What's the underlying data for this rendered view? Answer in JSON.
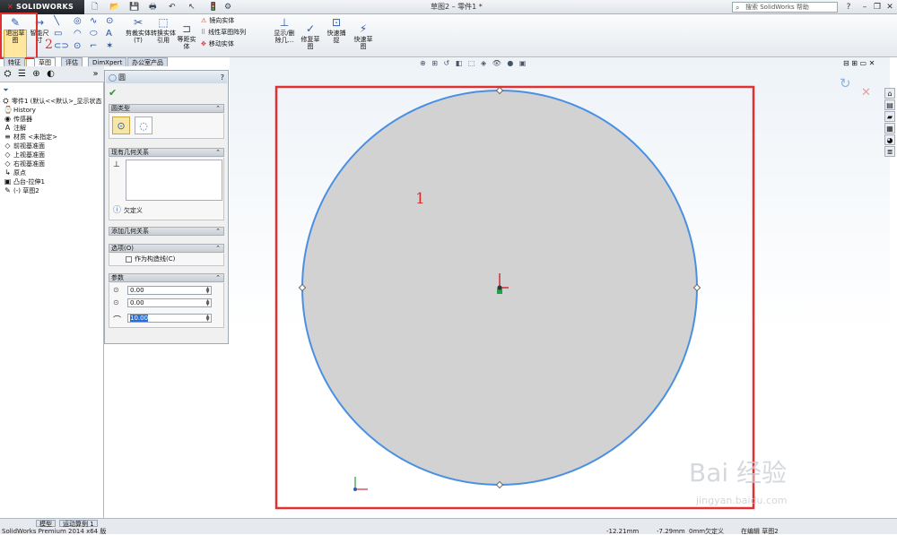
{
  "titlebar": {
    "brand": "SOLIDWORKS",
    "doc_title": "草图2 – 零件1 *",
    "search_placeholder": "搜索 SolidWorks 帮助"
  },
  "ribbon": {
    "exit_sketch": "退出草图",
    "smart_dim": "智能尺寸",
    "trim": "剪裁实体(T)",
    "convert": "转换实体引用",
    "offset": "等距实体",
    "mirror": "镜向实体",
    "linear_pattern": "线性草图阵列",
    "move": "移动实体",
    "display_delete": "显示/删除几...",
    "repair": "修复草图",
    "quick_snap": "快速捕捉",
    "rapid_sketch": "快速草图"
  },
  "annotations": {
    "a1": "1",
    "a2": "2"
  },
  "tabs": [
    "特征",
    "草图",
    "评估",
    "DimXpert",
    "办公室产品"
  ],
  "tree": {
    "root": "零件1 (默认<<默认>_显示状态",
    "items": [
      "History",
      "传感器",
      "注解",
      "材质 <未指定>",
      "前视基准面",
      "上视基准面",
      "右视基准面",
      "原点",
      "凸台-拉伸1",
      "(-) 草图2"
    ]
  },
  "pm": {
    "title": "圆",
    "circle_type": "圆类型",
    "existing_relations": "现有几何关系",
    "status": "欠定义",
    "add_relations": "添加几何关系",
    "options": "选项(O)",
    "construction": "作为构造线(C)",
    "params": "参数",
    "cx": "0.00",
    "cy": "0.00",
    "radius": "10.00"
  },
  "statusbar": {
    "tab_model": "模型",
    "tab_motion": "运动算例 1",
    "product": "SolidWorks Premium 2014 x64 版",
    "x": "-12.21mm",
    "y": "-7.29mm",
    "z": "0mm",
    "state": "欠定义",
    "editing": "在编辑 草图2"
  },
  "watermark": {
    "big": "Bai 经验",
    "small": "jingyan.baidu.com"
  },
  "colors": {
    "sketch_blue": "#4a90e2",
    "fill_gray": "#d2d2d2",
    "highlight_red": "#e03030"
  },
  "chart_data": {
    "type": "scatter",
    "title": "",
    "circle": {
      "center": [
        0.0,
        0.0
      ],
      "radius": 10.0
    },
    "points": [
      {
        "name": "center",
        "x": 0.0,
        "y": 0.0
      },
      {
        "name": "top",
        "x": 0.0,
        "y": 10.0
      },
      {
        "name": "bottom",
        "x": 0.0,
        "y": -10.0
      },
      {
        "name": "left",
        "x": -10.0,
        "y": 0.0
      },
      {
        "name": "right",
        "x": 10.0,
        "y": 0.0
      }
    ]
  }
}
